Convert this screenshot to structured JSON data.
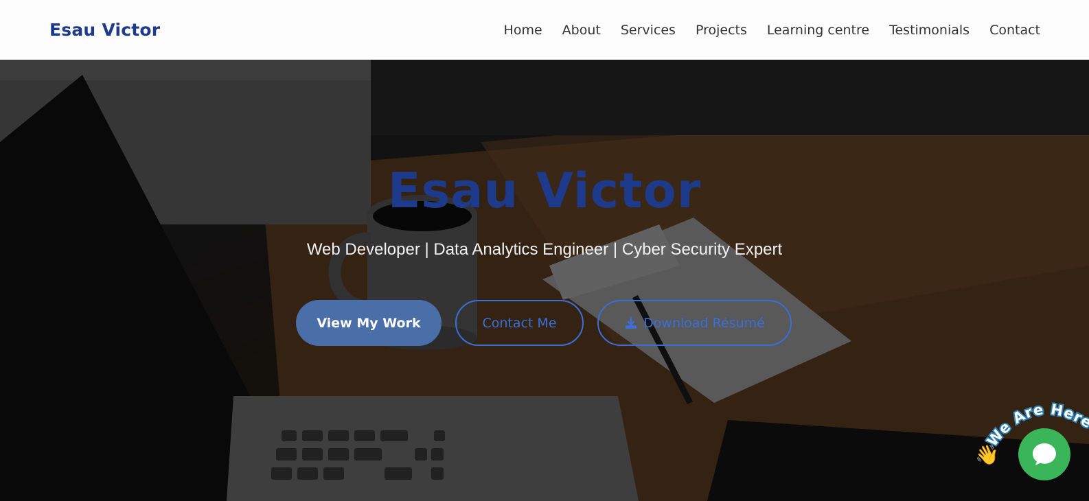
{
  "navbar": {
    "brand": "Esau Victor",
    "links": [
      "Home",
      "About",
      "Services",
      "Projects",
      "Learning centre",
      "Testimonials",
      "Contact"
    ]
  },
  "hero": {
    "title": "Esau Victor",
    "subtitle": "Web Developer | Data Analytics Engineer | Cyber Security Expert",
    "buttons": {
      "view_work": "View My Work",
      "contact": "Contact Me",
      "download": "Download Résumé"
    }
  },
  "chat": {
    "tagline": "We Are Here!",
    "icon": "chat-bubble-icon",
    "wave_icon": "waving-hand-icon",
    "wave_emoji": "👋"
  },
  "colors": {
    "brand": "#1e3a8a",
    "primary_button": "#4a6ea8",
    "outline": "#3b6fd8",
    "chat_green": "#3bb55a"
  }
}
